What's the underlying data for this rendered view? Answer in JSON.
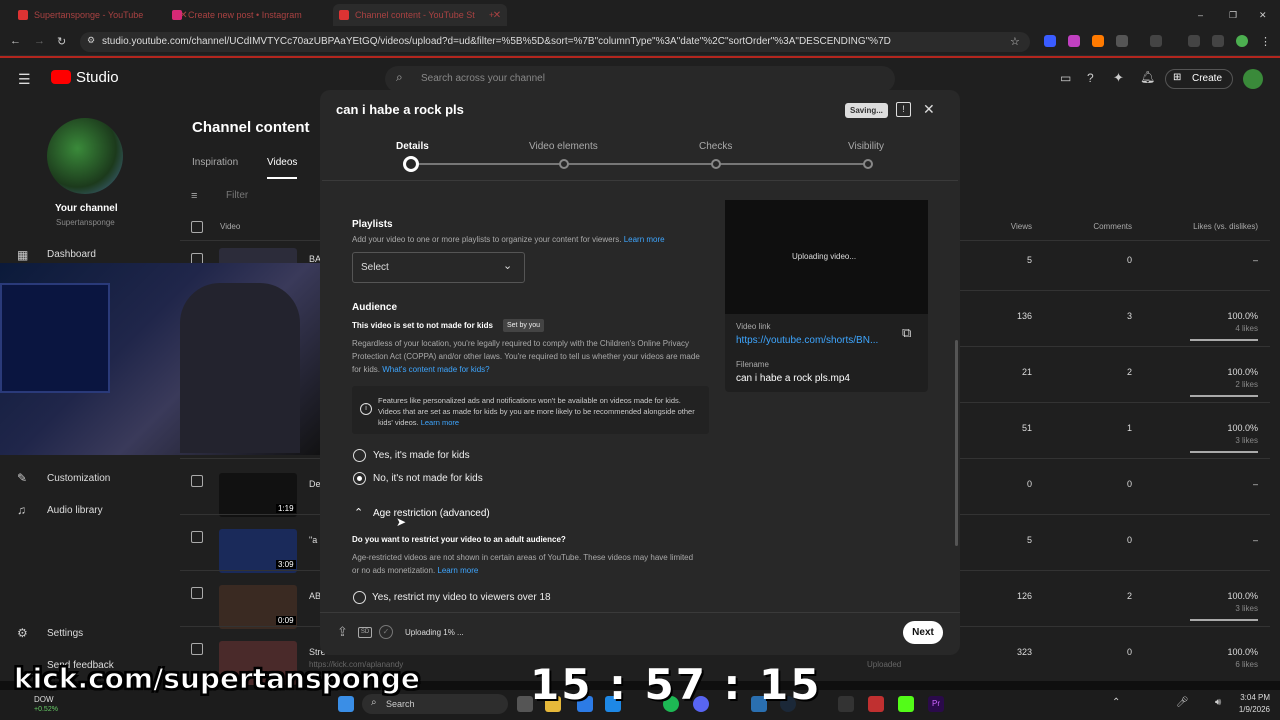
{
  "browser": {
    "tabs": [
      {
        "title": "Supertansponge - YouTube"
      },
      {
        "title": "Create new post • Instagram"
      },
      {
        "title": "Channel content - YouTube St"
      }
    ],
    "url": "studio.youtube.com/channel/UCdIMVTYCc70azUBPAaYEtGQ/videos/upload?d=ud&filter=%5B%5D&sort=%7B\"columnType\"%3A\"date\"%2C\"sortOrder\"%3A\"DESCENDING\"%7D"
  },
  "studio": {
    "logo": "Studio",
    "search_placeholder": "Search across your channel",
    "create_label": "Create"
  },
  "sidebar": {
    "your_channel": "Your channel",
    "channel_name": "Supertansponge",
    "items": [
      "Dashboard",
      "Customization",
      "Audio library",
      "Settings",
      "Send feedback"
    ]
  },
  "main": {
    "title": "Channel content",
    "tabs": [
      "Inspiration",
      "Videos"
    ],
    "filter": "Filter",
    "columns": {
      "video": "Video",
      "views": "Views",
      "comments": "Comments",
      "likes": "Likes (vs. dislikes)"
    },
    "rows": [
      {
        "prefix": "BA",
        "views": "5",
        "comments": "0",
        "likes": "–",
        "likes_sub": ""
      },
      {
        "prefix": "",
        "views": "136",
        "comments": "3",
        "likes": "100.0%",
        "likes_sub": "4 likes"
      },
      {
        "prefix": "",
        "views": "21",
        "comments": "2",
        "likes": "100.0%",
        "likes_sub": "2 likes"
      },
      {
        "prefix": "",
        "views": "51",
        "comments": "1",
        "likes": "100.0%",
        "likes_sub": "3 likes"
      },
      {
        "prefix": "De",
        "views": "0",
        "comments": "0",
        "likes": "–",
        "likes_sub": "",
        "duration": "1:19"
      },
      {
        "prefix": "\"a",
        "views": "5",
        "comments": "0",
        "likes": "–",
        "likes_sub": "",
        "duration": "3:09"
      },
      {
        "prefix": "AB",
        "views": "126",
        "comments": "2",
        "likes": "100.0%",
        "likes_sub": "3 likes",
        "duration": "0:09"
      },
      {
        "prefix": "Stre",
        "views": "323",
        "comments": "0",
        "likes": "100.0%",
        "likes_sub": "6 likes",
        "extra": "https://kick.com/aplanandy",
        "status": "Uploaded"
      }
    ]
  },
  "modal": {
    "title": "can i habe a rock pls",
    "saving": "Saving...",
    "steps": [
      "Details",
      "Video elements",
      "Checks",
      "Visibility"
    ],
    "playlists_title": "Playlists",
    "playlists_desc": "Add your video to one or more playlists to organize your content for viewers.",
    "learn_more": "Learn more",
    "select_label": "Select",
    "audience_title": "Audience",
    "audience_status": "This video is set to not made for kids",
    "set_by_you": "Set by you",
    "coppa_text": "Regardless of your location, you're legally required to comply with the Children's Online Privacy Protection Act (COPPA) and/or other laws. You're required to tell us whether your videos are made for kids.",
    "whats_kids": "What's content made for kids?",
    "info_text": "Features like personalized ads and notifications won't be available on videos made for kids. Videos that are set as made for kids by you are more likely to be recommended alongside other kids' videos.",
    "opt_yes_kids": "Yes, it's made for kids",
    "opt_no_kids": "No, it's not made for kids",
    "age_title": "Age restriction (advanced)",
    "age_question": "Do you want to restrict your video to an adult audience?",
    "age_desc": "Age-restricted videos are not shown in certain areas of YouTube. These videos may have limited or no ads monetization.",
    "opt_restrict": "Yes, restrict my video to viewers over 18",
    "preview_status": "Uploading video...",
    "video_link_label": "Video link",
    "video_link": "https://youtube.com/shorts/BN...",
    "filename_label": "Filename",
    "filename": "can i habe a rock pls.mp4",
    "upload_status": "Uploading 1% ...",
    "next": "Next"
  },
  "overlay": {
    "kick": "kick.com/supertansponge",
    "clock": "15 : 57 : 15"
  },
  "taskbar": {
    "search": "Search",
    "time": "3:04 PM",
    "date": "1/9/2026",
    "stock_name": "DOW",
    "stock_change": "+0.52%"
  },
  "colors": {
    "accent_link": "#3ea6ff",
    "brand_red": "#ff0000"
  }
}
